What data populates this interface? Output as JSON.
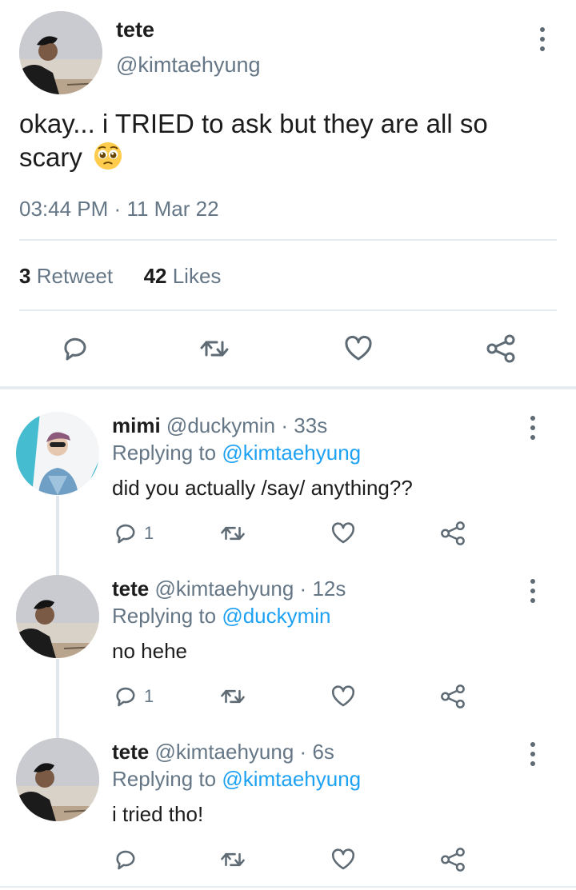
{
  "main_tweet": {
    "name": "tete",
    "handle": "@kimtaehyung",
    "text": "okay... i TRIED to ask but they are all so scary",
    "emoji_icon": "pleading-face-icon",
    "time": "03:44 PM",
    "date": "11 Mar 22",
    "time_sep": "·",
    "retweets": {
      "count": "3",
      "label": "Retweet"
    },
    "likes": {
      "count": "42",
      "label": "Likes"
    }
  },
  "replies": [
    {
      "name": "mimi",
      "handle": "@duckymin",
      "time": "33s",
      "sep": "·",
      "replying_label": "Replying to",
      "replying_to": "@kimtaehyung",
      "text": "did you actually /say/ anything??",
      "reply_count": "1"
    },
    {
      "name": "tete",
      "handle": "@kimtaehyung",
      "time": "12s",
      "sep": "·",
      "replying_label": "Replying to",
      "replying_to": "@duckymin",
      "text": "no hehe",
      "reply_count": "1"
    },
    {
      "name": "tete",
      "handle": "@kimtaehyung",
      "time": "6s",
      "sep": "·",
      "replying_label": "Replying to",
      "replying_to": "@kimtaehyung",
      "text": "i tried tho!",
      "reply_count": ""
    }
  ],
  "colors": {
    "accent": "#1da1f2",
    "muted": "#657786",
    "icon": "#5e6b75",
    "divider": "#e6ecf0"
  },
  "icons": [
    "reply-icon",
    "retweet-icon",
    "like-icon",
    "share-icon",
    "more-options-icon"
  ]
}
